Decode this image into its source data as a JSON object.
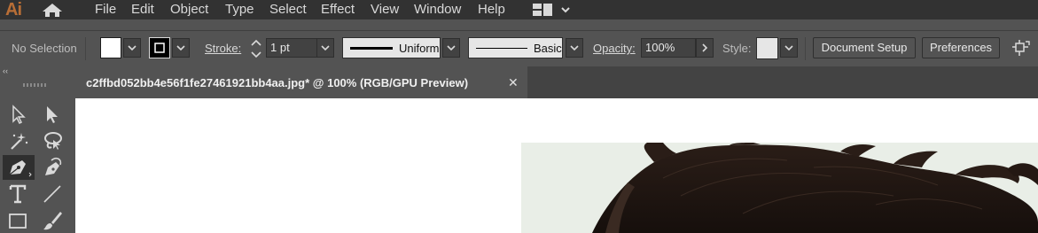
{
  "app": {
    "logo": "Ai"
  },
  "menu": {
    "items": [
      "File",
      "Edit",
      "Object",
      "Type",
      "Select",
      "Effect",
      "View",
      "Window",
      "Help"
    ]
  },
  "control_bar": {
    "selection_label": "No Selection",
    "stroke_label": "Stroke:",
    "stroke_weight": "1 pt",
    "variable_width_profile": "Uniform",
    "brush_definition": "Basic",
    "opacity_label": "Opacity:",
    "opacity_value": "100%",
    "style_label": "Style:",
    "document_setup": "Document Setup",
    "preferences": "Preferences",
    "colors": {
      "fill": "#ffffff",
      "stroke": "#000000"
    }
  },
  "document": {
    "tab_title": "c2ffbd052bb4e56f1fe27461921bb4aa.jpg* @ 100% (RGB/GPU Preview)",
    "close_glyph": "✕"
  },
  "panel_collapse_glyph": "‹‹",
  "tools": [
    {
      "name": "selection-tool-icon"
    },
    {
      "name": "direct-selection-tool-icon"
    },
    {
      "name": "magic-wand-tool-icon"
    },
    {
      "name": "lasso-tool-icon"
    },
    {
      "name": "pen-tool-icon"
    },
    {
      "name": "curvature-tool-icon"
    },
    {
      "name": "type-tool-icon"
    },
    {
      "name": "line-segment-tool-icon"
    },
    {
      "name": "rectangle-tool-icon"
    },
    {
      "name": "paintbrush-tool-icon"
    }
  ],
  "theme": {
    "accent_logo": "#b86e36",
    "ui_dark": "#323232",
    "ui_mid": "#535353"
  }
}
